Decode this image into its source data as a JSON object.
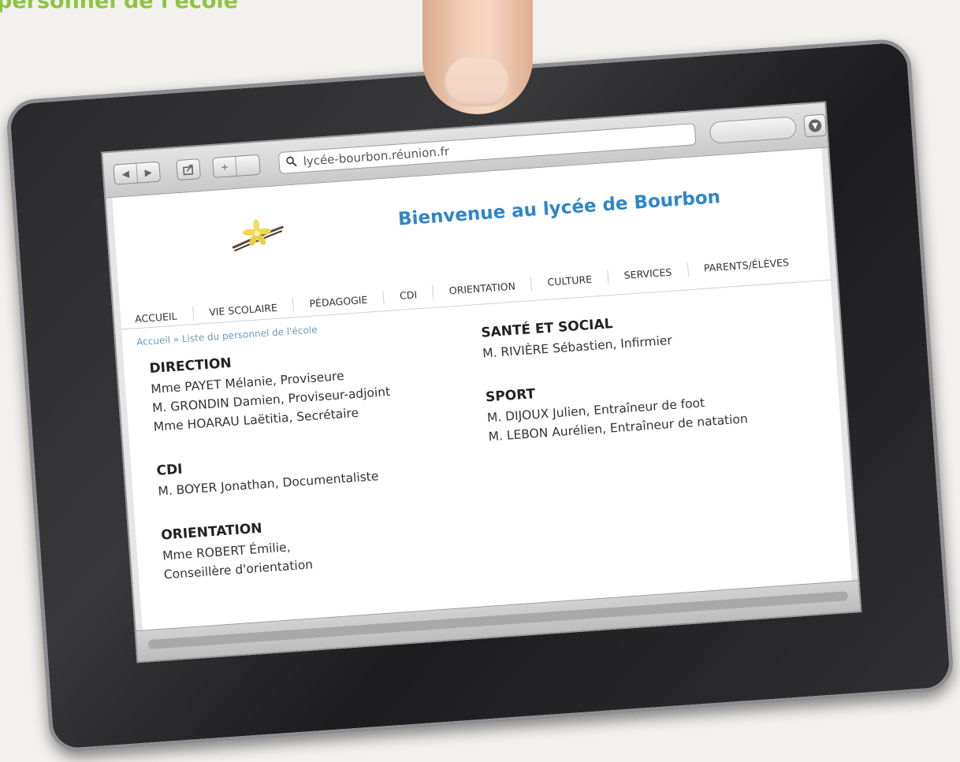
{
  "page_heading": "personnel de l'école",
  "browser": {
    "url": "lycée-bourbon.réunion.fr",
    "icons": {
      "back": "triangle-left",
      "forward": "triangle-right",
      "share": "share-box",
      "add": "plus",
      "search": "magnifier",
      "download": "down-arrow-circle"
    }
  },
  "site": {
    "title": "Bienvenue au lycée de Bourbon",
    "nav": [
      "ACCUEIL",
      "VIE SCOLAIRE",
      "PÉDAGOGIE",
      "CDI",
      "ORIENTATION",
      "CULTURE",
      "SERVICES",
      "PARENTS/ÉLÈVES"
    ],
    "breadcrumb": "Accueil » Liste du personnel de l'école"
  },
  "staff": {
    "direction": {
      "title": "DIRECTION",
      "people": [
        "Mme PAYET Mélanie, Proviseure",
        "M. GRONDIN Damien, Proviseur-adjoint",
        "Mme HOARAU Laëtitia, Secrétaire"
      ]
    },
    "cdi": {
      "title": "CDI",
      "people": [
        "M. BOYER Jonathan, Documentaliste"
      ]
    },
    "orientation": {
      "title": "ORIENTATION",
      "people": [
        "Mme ROBERT Émilie,",
        "Conseillère d'orientation"
      ]
    },
    "sante": {
      "title": "SANTÉ ET SOCIAL",
      "people": [
        "M. RIVIÈRE Sébastien, Infirmier"
      ]
    },
    "sport": {
      "title": "SPORT",
      "people": [
        "M. DIJOUX Julien, Entraîneur de foot",
        "M. LEBON Aurélien, Entraîneur de natation"
      ]
    }
  },
  "colors": {
    "heading_green": "#8cc63f",
    "title_blue": "#2f86c8",
    "breadcrumb_blue": "#6a9ac4"
  }
}
